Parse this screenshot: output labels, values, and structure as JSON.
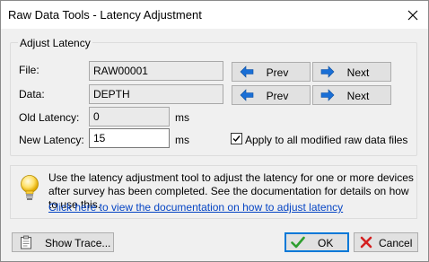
{
  "window": {
    "title": "Raw Data Tools - Latency Adjustment"
  },
  "adjust": {
    "group_label": "Adjust Latency",
    "file_label": "File:",
    "file_value": "RAW00001",
    "data_label": "Data:",
    "data_value": "DEPTH",
    "old_latency_label": "Old Latency:",
    "old_latency_value": "0",
    "old_latency_unit": "ms",
    "new_latency_label": "New Latency:",
    "new_latency_value": "15",
    "new_latency_unit": "ms",
    "apply_all_label": "Apply to all modified raw data files",
    "apply_all_checked": true
  },
  "nav": {
    "file_prev": "Prev",
    "file_next": "Next",
    "data_prev": "Prev",
    "data_next": "Next"
  },
  "info": {
    "text": "Use the latency adjustment tool to adjust the latency for one or more devices after survey has been completed. See the documentation for details on how to use this.",
    "link": "Click here to view the documentation on how to adjust latency"
  },
  "buttons": {
    "show_trace": "Show Trace...",
    "ok": "OK",
    "cancel": "Cancel"
  },
  "colors": {
    "arrow_blue": "#1a6fd6",
    "ok_green": "#2e9e2e",
    "cancel_red": "#d42020",
    "link_blue": "#0645c4"
  },
  "icons": {
    "close": "close-icon",
    "prev_arrow": "arrow-left-icon",
    "next_arrow": "arrow-right-icon",
    "info": "lightbulb-icon",
    "trace": "clipboard-icon",
    "ok": "checkmark-icon",
    "cancel": "x-icon"
  }
}
